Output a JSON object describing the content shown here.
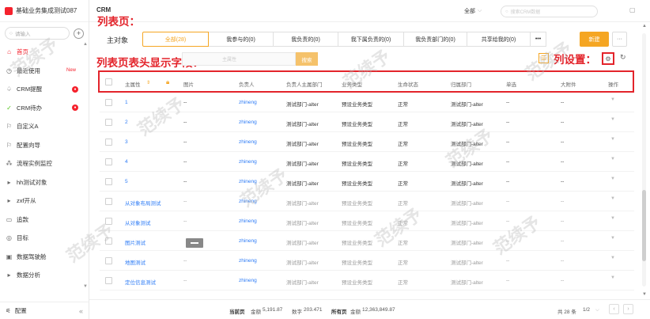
{
  "sidebar": {
    "app_name": "基础业务集成测试087",
    "search_placeholder": "请输入",
    "items": [
      {
        "label": "首页",
        "icon": "home-icon",
        "glyph": "⌂",
        "active": true
      },
      {
        "label": "最近使用",
        "icon": "clock-icon",
        "glyph": "◷",
        "badge": "New"
      },
      {
        "label": "CRM提醒",
        "icon": "bell-icon",
        "glyph": "♤",
        "dot": "●"
      },
      {
        "label": "CRM待办",
        "icon": "check-circle-icon",
        "glyph": "✓",
        "dot": "●"
      },
      {
        "label": "自定义A",
        "icon": "flag-icon",
        "glyph": "⚐"
      },
      {
        "label": "配置向导",
        "icon": "flag-icon",
        "glyph": "⚐"
      },
      {
        "label": "流程实例监控",
        "icon": "flow-icon",
        "glyph": "⁂"
      },
      {
        "label": "hh测试对象",
        "icon": "caret-right-icon",
        "glyph": "▸"
      },
      {
        "label": "zxf开从",
        "icon": "caret-right-icon",
        "glyph": "▸"
      },
      {
        "label": "追款",
        "icon": "card-icon",
        "glyph": "▭"
      },
      {
        "label": "目标",
        "icon": "target-icon",
        "glyph": "◎"
      },
      {
        "label": "数据驾驶舱",
        "icon": "dashboard-icon",
        "glyph": "▣"
      },
      {
        "label": "数据分析",
        "icon": "caret-right-icon",
        "glyph": "▸"
      }
    ],
    "config_label": "配置"
  },
  "header": {
    "module_title": "CRM",
    "scope_select": "全部",
    "search_placeholder": "搜索CRM数据"
  },
  "annotations": {
    "list_page": "列表页：",
    "header_fields": "列表页表头显示字段：",
    "column_settings": "列设置："
  },
  "main": {
    "object_label": "主对象",
    "tabs": [
      {
        "label": "全部(28)",
        "active": true,
        "w": 84
      },
      {
        "label": "我参与的(0)",
        "w": 82
      },
      {
        "label": "我负责的(0)",
        "w": 82
      },
      {
        "label": "我下属负责的(0)",
        "w": 83
      },
      {
        "label": "我负责部门的(0)",
        "w": 80
      },
      {
        "label": "共享给我的(0)",
        "w": 80
      }
    ],
    "tab_more": "•••",
    "new_button": "新建",
    "more_button": "···",
    "filter_placeholder": "主属性",
    "filter_button": "搜索"
  },
  "table": {
    "columns": [
      "主属性",
      "图片",
      "负责人",
      "负责人主属部门",
      "业务类型",
      "生命状态",
      "归属部门",
      "单选",
      "大附件",
      "操作"
    ],
    "rows": [
      {
        "name": "1",
        "img": "--",
        "owner": "zhineng",
        "dept": "测试部门-alter",
        "type": "预设业务类型",
        "status": "正常",
        "home": "测试部门-alter",
        "single": "--",
        "attach": "--"
      },
      {
        "name": "2",
        "img": "--",
        "owner": "zhineng",
        "dept": "测试部门-alter",
        "type": "预设业务类型",
        "status": "正常",
        "home": "测试部门-alter",
        "single": "--",
        "attach": "--"
      },
      {
        "name": "3",
        "img": "--",
        "owner": "zhineng",
        "dept": "测试部门-alter",
        "type": "预设业务类型",
        "status": "正常",
        "home": "测试部门-alter",
        "single": "--",
        "attach": "--"
      },
      {
        "name": "4",
        "img": "--",
        "owner": "zhineng",
        "dept": "测试部门-alter",
        "type": "预设业务类型",
        "status": "正常",
        "home": "测试部门-alter",
        "single": "--",
        "attach": "--"
      },
      {
        "name": "5",
        "img": "--",
        "owner": "zhineng",
        "dept": "测试部门-alter",
        "type": "预设业务类型",
        "status": "正常",
        "home": "测试部门-alter",
        "single": "--",
        "attach": "--"
      },
      {
        "name": "从对象布局测试",
        "img": "--",
        "owner": "zhineng",
        "dept": "测试部门-alter",
        "type": "预设业务类型",
        "status": "正常",
        "home": "测试部门-alter",
        "single": "--",
        "attach": "--"
      },
      {
        "name": "从对象测试",
        "img": "--",
        "owner": "zhineng",
        "dept": "测试部门-alter",
        "type": "预设业务类型",
        "status": "正常",
        "home": "测试部门-alter",
        "single": "--",
        "attach": "--"
      },
      {
        "name": "图片测试",
        "img": "",
        "owner": "zhineng",
        "dept": "测试部门-alter",
        "type": "预设业务类型",
        "status": "正常",
        "home": "测试部门-alter",
        "single": "--",
        "attach": "--"
      },
      {
        "name": "地图测试",
        "img": "--",
        "owner": "zhineng",
        "dept": "测试部门-alter",
        "type": "预设业务类型",
        "status": "正常",
        "home": "测试部门-alter",
        "single": "--",
        "attach": "--"
      },
      {
        "name": "定位信息测试",
        "img": "--",
        "owner": "zhineng",
        "dept": "测试部门-alter",
        "type": "预设业务类型",
        "status": "正常",
        "home": "测试部门-alter",
        "single": "--",
        "attach": "--"
      }
    ],
    "op_glyph": "▼"
  },
  "footer": {
    "current_page": "当前页",
    "amount_label": "金额",
    "amount_current": "5,191.87",
    "number_label": "数字",
    "number_current": "203.471",
    "all_label": "所有页",
    "amount_all_label": "金额",
    "amount_all": "12,363,849.87",
    "total": "共 28 条",
    "page": "1/2",
    "prev": "‹",
    "next": "›"
  },
  "watermark_text": "范续予",
  "colors": {
    "accent": "#f5a623",
    "annotation": "#e3242b",
    "link": "#2e7cf6"
  }
}
